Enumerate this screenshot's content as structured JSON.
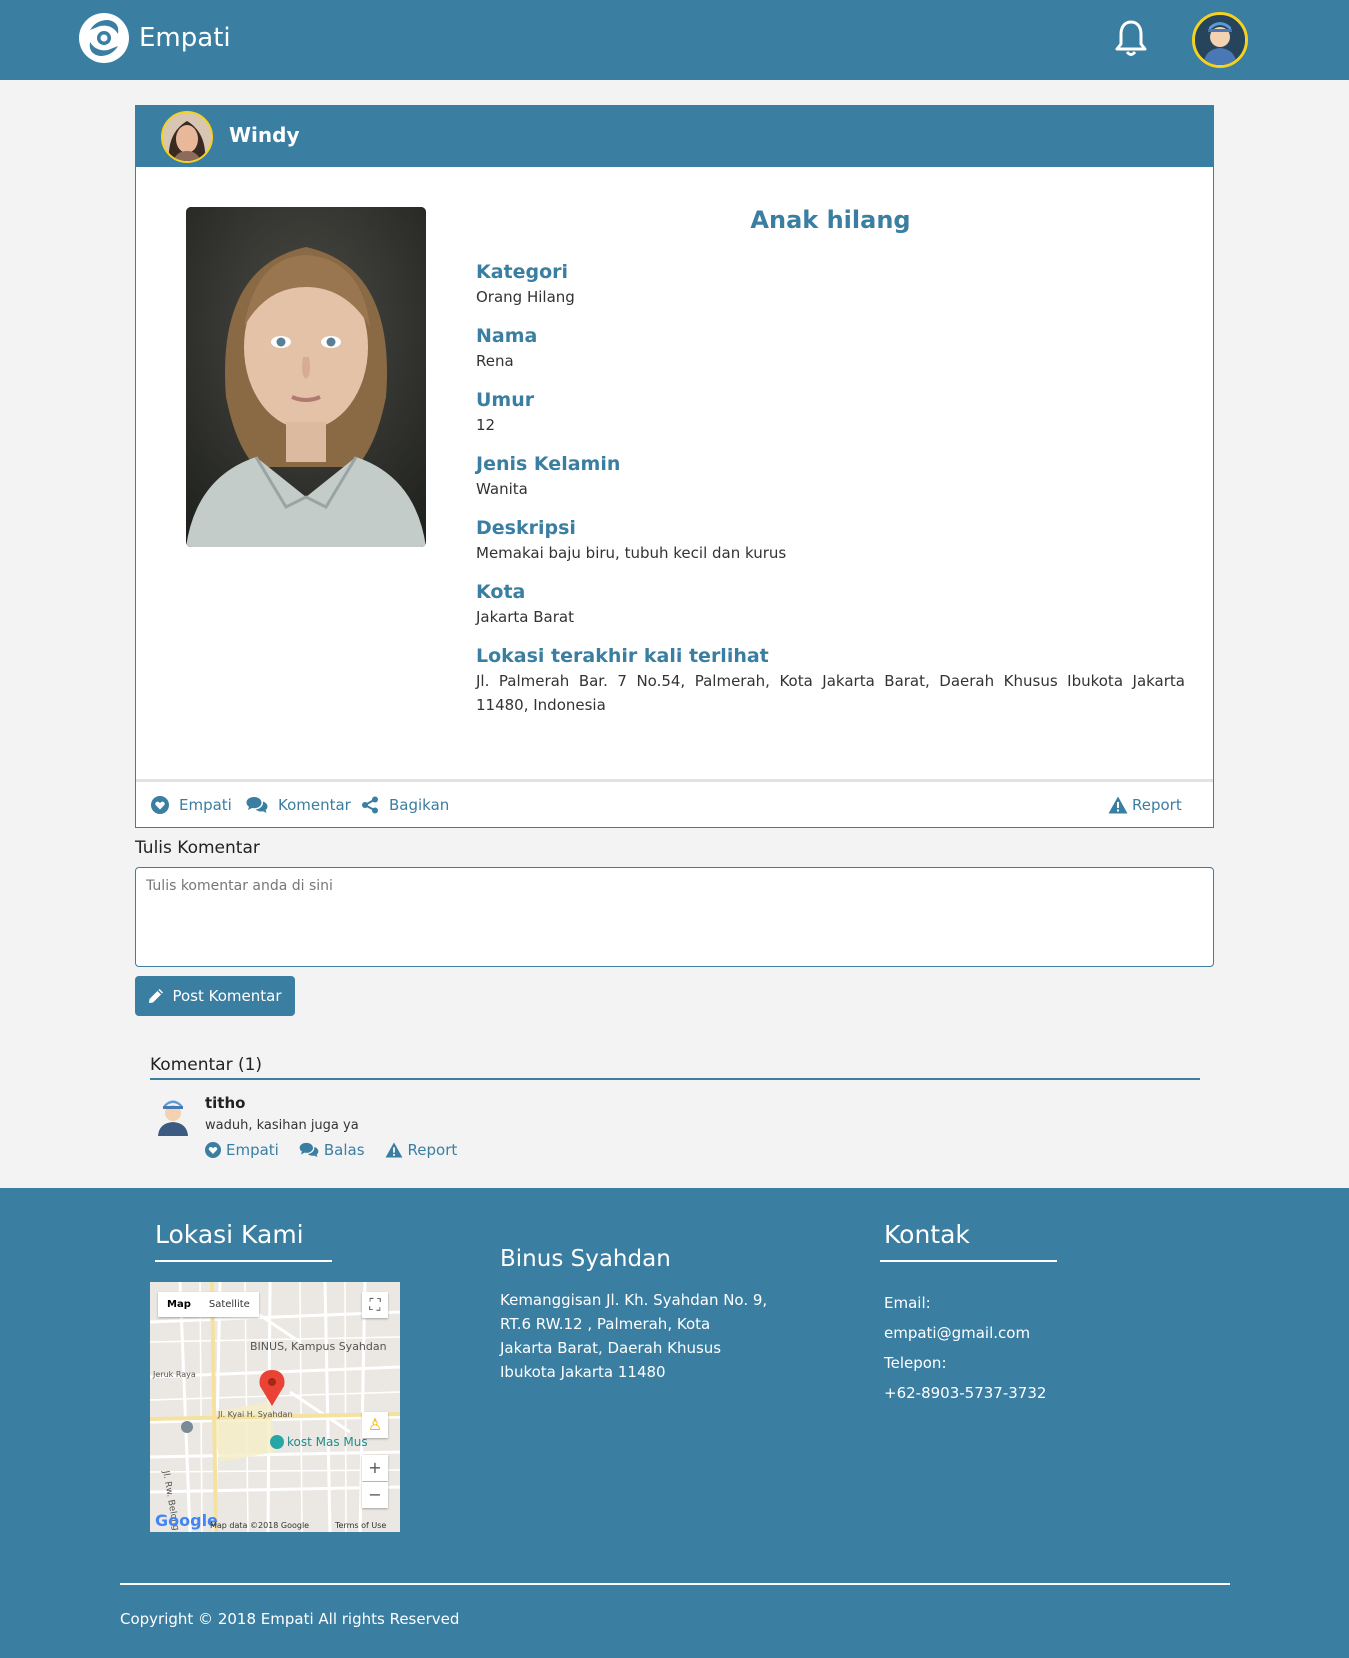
{
  "navbar": {
    "brand": "Empati",
    "brand_logo_icon": "empati-logo-icon",
    "notification_icon": "bell-icon",
    "user_avatar_icon": "user-avatar-icon",
    "color": "#3a7ea1"
  },
  "post": {
    "author": "Windy",
    "title": "Anak hilang",
    "fields": [
      {
        "label": "Kategori",
        "value": "Orang Hilang"
      },
      {
        "label": "Nama",
        "value": "Rena"
      },
      {
        "label": "Umur",
        "value": "12"
      },
      {
        "label": "Jenis Kelamin",
        "value": "Wanita"
      },
      {
        "label": "Deskripsi",
        "value": "Memakai baju biru, tubuh kecil dan kurus"
      },
      {
        "label": "Kota",
        "value": "Jakarta Barat"
      },
      {
        "label": "Lokasi terakhir kali terlihat",
        "value": "Jl. Palmerah Bar. 7 No.54, Palmerah, Kota Jakarta Barat, Daerah Khusus Ibukota Jakarta 11480, Indonesia"
      }
    ],
    "actions": {
      "empati": "Empati",
      "komentar": "Komentar",
      "bagikan": "Bagikan",
      "report": "Report"
    }
  },
  "comment_form": {
    "label": "Tulis Komentar",
    "placeholder": "Tulis komentar anda di sini",
    "value": "",
    "submit": "Post Komentar"
  },
  "comments": {
    "title": "Komentar (1)",
    "items": [
      {
        "author": "titho",
        "text": "waduh, kasihan juga ya",
        "actions": {
          "empati": "Empati",
          "balas": "Balas",
          "report": "Report"
        }
      }
    ]
  },
  "footer": {
    "location_heading": "Lokasi Kami",
    "map": {
      "tab_map": "Map",
      "tab_satellite": "Satellite",
      "place_campus": "BINUS, Kampus Syahdan",
      "place_kost": "kost Mas Mus",
      "street_1": "Jl. Kyai H. Syahdan",
      "street_2": "Jl. Rw. Belong",
      "street_3": "Jeruk Raya",
      "attribution": "Map data ©2018 Google",
      "terms": "Terms of Use",
      "zoom_in": "+",
      "zoom_out": "−"
    },
    "address_title": "Binus Syahdan",
    "address_lines": [
      "Kemanggisan Jl. Kh. Syahdan No. 9,",
      "RT.6 RW.12 , Palmerah, Kota",
      "Jakarta Barat, Daerah Khusus",
      "Ibukota Jakarta 11480"
    ],
    "contact_heading": "Kontak",
    "contact": {
      "email_label": "Email:",
      "email": "empati@gmail.com",
      "phone_label": "Telepon:",
      "phone": "+62-8903-5737-3732"
    },
    "copyright": "Copyright © 2018 Empati All rights Reserved"
  }
}
